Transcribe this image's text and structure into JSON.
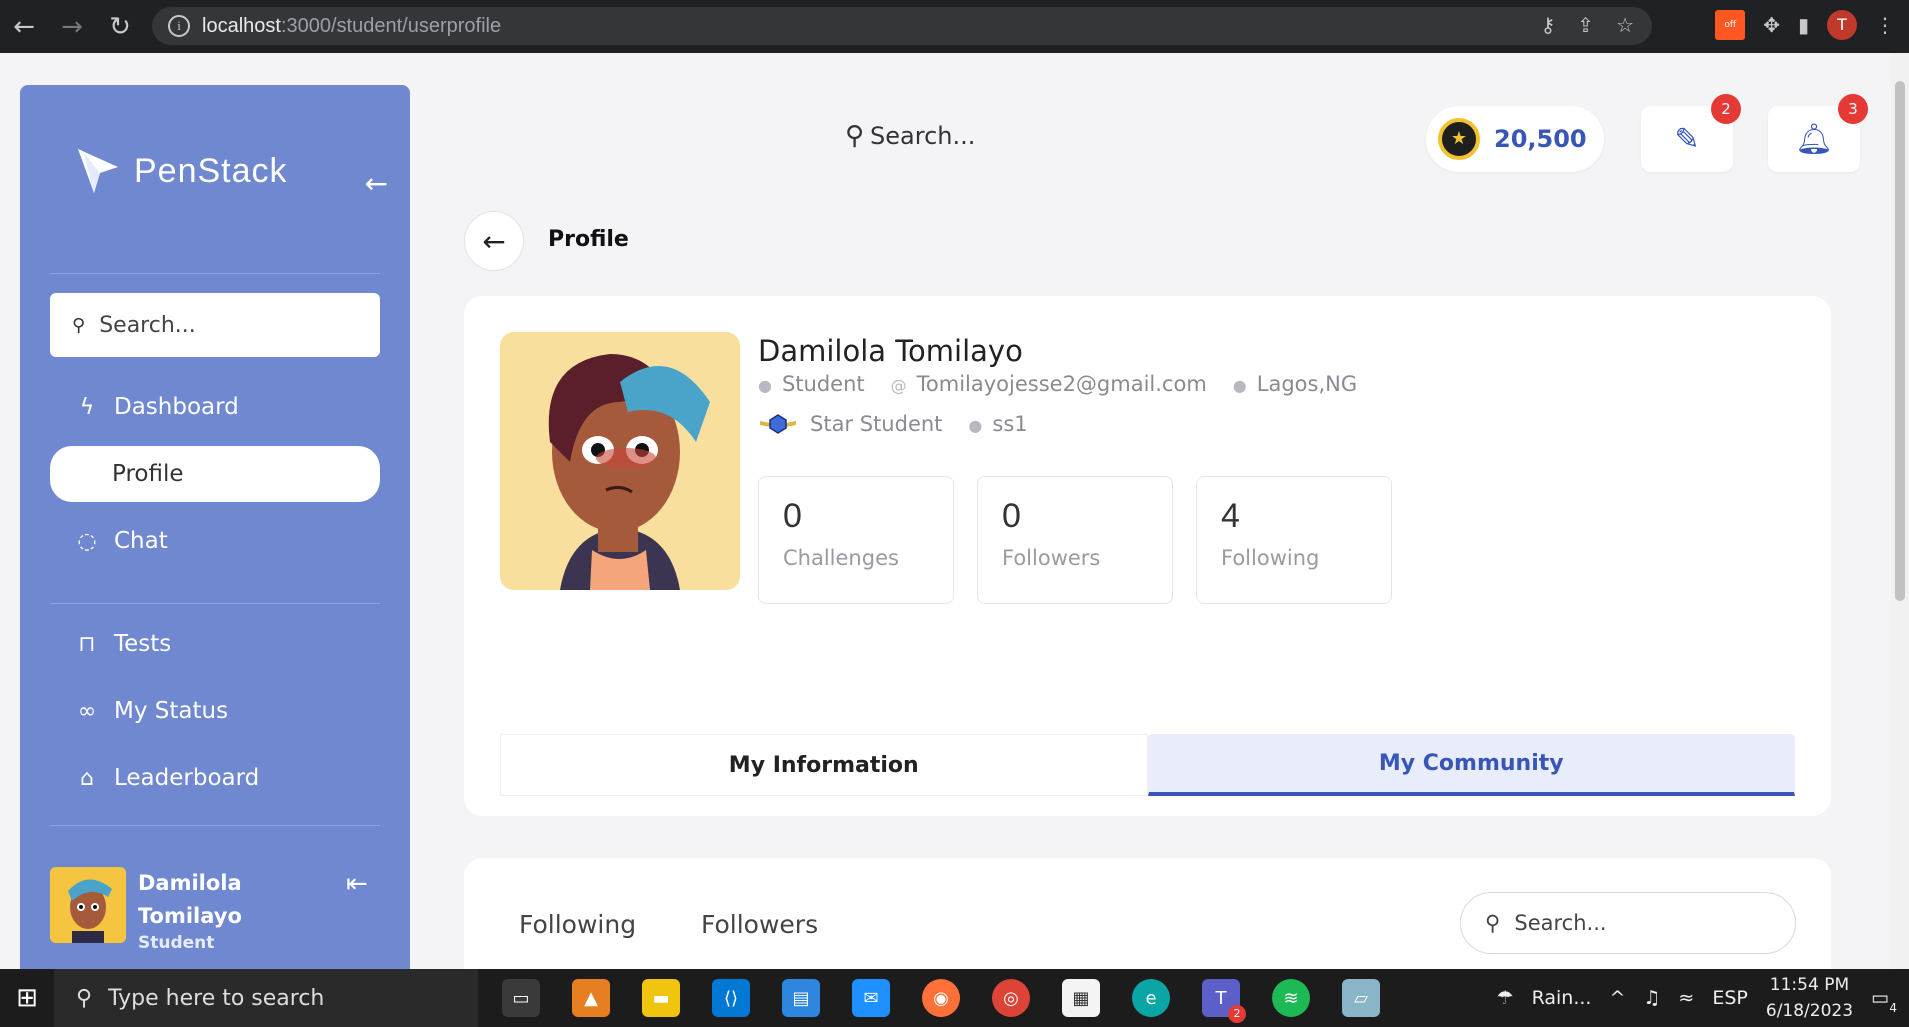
{
  "browser": {
    "url_host": "localhost",
    "url_path": ":3000/student/userprofile"
  },
  "sidebar": {
    "brand": "PenStack",
    "search_placeholder": "Search...",
    "items": [
      {
        "label": "Dashboard",
        "icon": "bolt-icon"
      },
      {
        "label": "Profile",
        "icon": "user-icon"
      },
      {
        "label": "Chat",
        "icon": "chat-icon"
      },
      {
        "label": "Tests",
        "icon": "book-icon"
      },
      {
        "label": "My Status",
        "icon": "infinity-icon"
      },
      {
        "label": "Leaderboard",
        "icon": "bag-icon"
      }
    ],
    "user": {
      "first": "Damilola",
      "last": "Tomilayo",
      "role": "Student"
    }
  },
  "topbar": {
    "search_placeholder": "Search...",
    "coins": "20,500",
    "messages_badge": "2",
    "notifications_badge": "3"
  },
  "header": {
    "title": "Profile"
  },
  "profile": {
    "name": "Damilola Tomilayo",
    "role": "Student",
    "email": "Tomilayojesse2@gmail.com",
    "location": "Lagos,NG",
    "rank": "Star Student",
    "class": "ss1",
    "stats": [
      {
        "value": "0",
        "label": "Challenges"
      },
      {
        "value": "0",
        "label": "Followers"
      },
      {
        "value": "4",
        "label": "Following"
      }
    ],
    "tabs": [
      {
        "label": "My Information",
        "active": false
      },
      {
        "label": "My Community",
        "active": true
      }
    ]
  },
  "community": {
    "tab_following": "Following",
    "tab_followers": "Followers",
    "search_placeholder": "Search..."
  },
  "taskbar": {
    "search_placeholder": "Type here to search",
    "weather": "Rain...",
    "lang": "ESP",
    "time": "11:54 PM",
    "date": "6/18/2023",
    "notif_count": "4",
    "teams_badge": "2"
  },
  "colors": {
    "sidebar_bg": "#7088d0",
    "accent": "#3856b8",
    "badge": "#e53935"
  }
}
